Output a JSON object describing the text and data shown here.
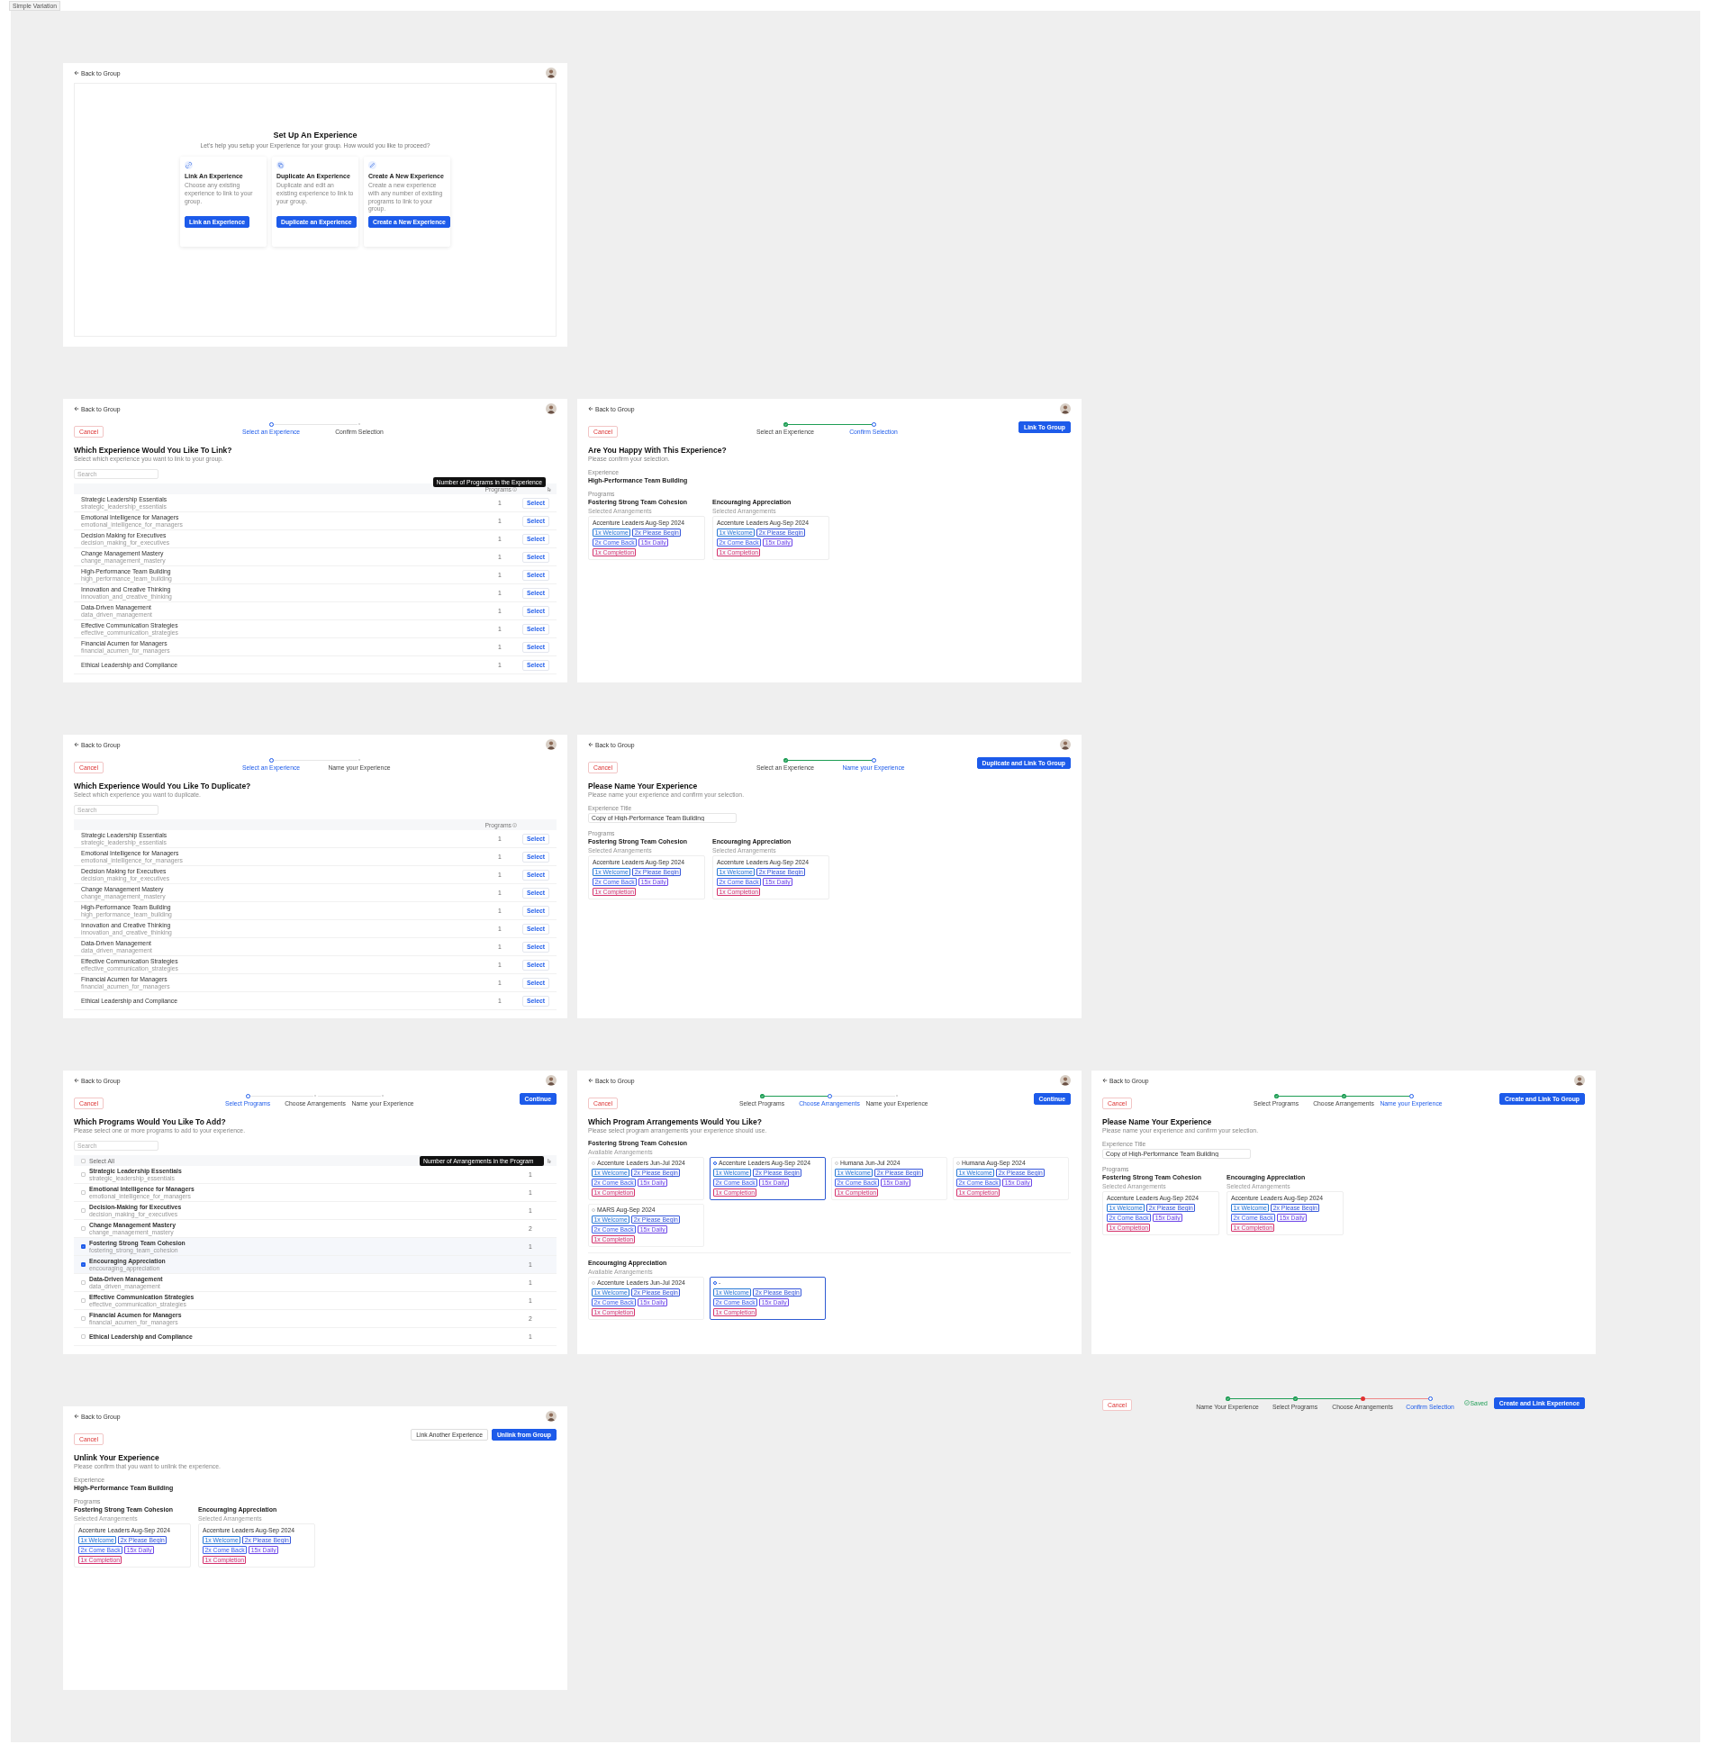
{
  "canvas_label": "Simple Variation",
  "frames": [
    {
      "kind": "setup",
      "back": "Back to Group",
      "title": "Set Up An Experience",
      "subtitle": "Let's help you setup your Experience for your group. How would you like to proceed?",
      "options": [
        {
          "title": "Link An Experience",
          "text": "Choose any existing experience to link to your group.",
          "button": "Link an Experience"
        },
        {
          "title": "Duplicate An Experience",
          "text": "Duplicate and edit an existing experience to link to your group.",
          "button": "Duplicate an Experience"
        },
        {
          "title": "Create A New Experience",
          "text": "Create a new experience with any number of existing programs to link to your group.",
          "button": "Create a New Experience"
        }
      ]
    },
    {
      "kind": "select",
      "back": "Back to Group",
      "cancel": "Cancel",
      "steps": [
        {
          "label": "Select an Experience",
          "done": false,
          "selected": true
        },
        {
          "label": "Confirm Selection",
          "done": false,
          "selected": false
        }
      ],
      "title": "Which Experience Would You Like To Link?",
      "subtitle": "Select which experience you want to link to your group.",
      "search": {
        "placeholder": "Search"
      },
      "count_header": "Programs",
      "tooltip": "Number of Programs in the Experience",
      "rows": [
        {
          "name": "Strategic Leadership Essentials",
          "slug": "strategic_leadership_essentials",
          "count": "1",
          "action": "Select"
        },
        {
          "name": "Emotional Intelligence for Managers",
          "slug": "emotional_intelligence_for_managers",
          "count": "1",
          "action": "Select"
        },
        {
          "name": "Decision Making for Executives",
          "slug": "decision_making_for_executives",
          "count": "1",
          "action": "Select"
        },
        {
          "name": "Change Management Mastery",
          "slug": "change_management_mastery",
          "count": "1",
          "action": "Select"
        },
        {
          "name": "High-Performance Team Building",
          "slug": "high_performance_team_building",
          "count": "1",
          "action": "Select"
        },
        {
          "name": "Innovation and Creative Thinking",
          "slug": "innovation_and_creative_thinking",
          "count": "1",
          "action": "Select"
        },
        {
          "name": "Data-Driven Management",
          "slug": "data_driven_management",
          "count": "1",
          "action": "Select"
        },
        {
          "name": "Effective Communication Strategies",
          "slug": "effective_communication_strategies",
          "count": "1",
          "action": "Select"
        },
        {
          "name": "Financial Acumen for Managers",
          "slug": "financial_acumen_for_managers",
          "count": "1",
          "action": "Select"
        },
        {
          "name": "Ethical Leadership and Compliance",
          "count": "1",
          "action": "Select"
        }
      ]
    },
    {
      "kind": "confirm",
      "back": "Back to Group",
      "cancel": "Cancel",
      "steps": [
        {
          "label": "Select an Experience",
          "done": true,
          "selected": false
        },
        {
          "label": "Confirm Selection",
          "done": false,
          "selected": true
        }
      ],
      "actions": [
        "Link To Group"
      ],
      "title": "Are You Happy With This Experience?",
      "subtitle": "Please confirm your selection.",
      "experience_label": "Experience",
      "experience": "High-Performance Team Building",
      "programs_label": "Programs",
      "programs": [
        {
          "name": "Fostering Strong Team Cohesion",
          "label": "Selected Arrangements",
          "arrangement": {
            "title": "Accenture Leaders Aug-Sep 2024",
            "tags": [
              {
                "label": "1x Welcome",
                "color": "#2b7bd6"
              },
              {
                "label": "2x Please Begin",
                "color": "#3b5bdb"
              },
              {
                "label": "2x Come Back",
                "color": "#4263eb"
              },
              {
                "label": "15x Daily",
                "color": "#7048e8"
              },
              {
                "label": "1x Completion",
                "color": "#d6336c"
              }
            ]
          }
        },
        {
          "name": "Encouraging Appreciation",
          "label": "Selected Arrangements",
          "arrangement": {
            "title": "Accenture Leaders Aug-Sep 2024",
            "tags": [
              {
                "label": "1x Welcome",
                "color": "#2b7bd6"
              },
              {
                "label": "2x Please Begin",
                "color": "#3b5bdb"
              },
              {
                "label": "2x Come Back",
                "color": "#4263eb"
              },
              {
                "label": "15x Daily",
                "color": "#7048e8"
              },
              {
                "label": "1x Completion",
                "color": "#d6336c"
              }
            ]
          }
        }
      ]
    },
    {
      "kind": "select",
      "back": "Back to Group",
      "cancel": "Cancel",
      "steps": [
        {
          "label": "Select an Experience",
          "done": false,
          "selected": true
        },
        {
          "label": "Name your Experience",
          "done": false,
          "selected": false
        }
      ],
      "title": "Which Experience Would You Like To Duplicate?",
      "subtitle": "Select which experience you want to duplicate.",
      "search": {
        "placeholder": "Search"
      },
      "count_header": "Programs",
      "rows": [
        {
          "name": "Strategic Leadership Essentials",
          "slug": "strategic_leadership_essentials",
          "count": "1",
          "action": "Select"
        },
        {
          "name": "Emotional Intelligence for Managers",
          "slug": "emotional_intelligence_for_managers",
          "count": "1",
          "action": "Select"
        },
        {
          "name": "Decision Making for Executives",
          "slug": "decision_making_for_executives",
          "count": "1",
          "action": "Select"
        },
        {
          "name": "Change Management Mastery",
          "slug": "change_management_mastery",
          "count": "1",
          "action": "Select"
        },
        {
          "name": "High-Performance Team Building",
          "slug": "high_performance_team_building",
          "count": "1",
          "action": "Select"
        },
        {
          "name": "Innovation and Creative Thinking",
          "slug": "innovation_and_creative_thinking",
          "count": "1",
          "action": "Select"
        },
        {
          "name": "Data-Driven Management",
          "slug": "data_driven_management",
          "count": "1",
          "action": "Select"
        },
        {
          "name": "Effective Communication Strategies",
          "slug": "effective_communication_strategies",
          "count": "1",
          "action": "Select"
        },
        {
          "name": "Financial Acumen for Managers",
          "slug": "financial_acumen_for_managers",
          "count": "1",
          "action": "Select"
        },
        {
          "name": "Ethical Leadership and Compliance",
          "count": "1",
          "action": "Select"
        }
      ]
    },
    {
      "kind": "name",
      "back": "Back to Group",
      "cancel": "Cancel",
      "steps": [
        {
          "label": "Select an Experience",
          "done": true,
          "selected": false
        },
        {
          "label": "Name your Experience",
          "done": false,
          "selected": true
        }
      ],
      "actions": [
        "Duplicate and Link To Group"
      ],
      "title": "Please Name Your Experience",
      "subtitle": "Please name your experience and confirm your selection.",
      "field": {
        "label": "Experience Title",
        "value": "Copy of High-Performance Team Building"
      },
      "programs_label": "Programs",
      "programs": [
        {
          "name": "Fostering Strong Team Cohesion",
          "label": "Selected Arrangements",
          "arrangement": {
            "title": "Accenture Leaders Aug-Sep 2024",
            "tags": [
              {
                "label": "1x Welcome",
                "color": "#2b7bd6"
              },
              {
                "label": "2x Please Begin",
                "color": "#3b5bdb"
              },
              {
                "label": "2x Come Back",
                "color": "#4263eb"
              },
              {
                "label": "15x Daily",
                "color": "#7048e8"
              },
              {
                "label": "1x Completion",
                "color": "#d6336c"
              }
            ]
          }
        },
        {
          "name": "Encouraging Appreciation",
          "label": "Selected Arrangements",
          "arrangement": {
            "title": "Accenture Leaders Aug-Sep 2024",
            "tags": [
              {
                "label": "1x Welcome",
                "color": "#2b7bd6"
              },
              {
                "label": "2x Please Begin",
                "color": "#3b5bdb"
              },
              {
                "label": "2x Come Back",
                "color": "#4263eb"
              },
              {
                "label": "15x Daily",
                "color": "#7048e8"
              },
              {
                "label": "1x Completion",
                "color": "#d6336c"
              }
            ]
          }
        }
      ]
    },
    {
      "kind": "programs",
      "back": "Back to Group",
      "cancel": "Cancel",
      "steps": [
        {
          "label": "Select Programs",
          "done": false,
          "selected": true
        },
        {
          "label": "Choose Arrangements",
          "done": false,
          "selected": false
        },
        {
          "label": "Name your Experience",
          "done": false,
          "selected": false
        }
      ],
      "actions": [
        "Continue"
      ],
      "title": "Which Programs Would You Like To Add?",
      "subtitle": "Please select one or more programs to add to your experience.",
      "search": {
        "placeholder": "Search"
      },
      "select_all": {
        "label": "Select All",
        "checked": false
      },
      "tooltip": "Number of Arrangements in the Program",
      "rows": [
        {
          "name": "Strategic Leadership Essentials",
          "slug": "strategic_leadership_essentials",
          "count": "1",
          "checked": false
        },
        {
          "name": "Emotional Intelligence for Managers",
          "slug": "emotional_intelligence_for_managers",
          "count": "1",
          "checked": false
        },
        {
          "name": "Decision-Making for Executives",
          "slug": "decision_making_for_executives",
          "count": "1",
          "checked": false
        },
        {
          "name": "Change Management Mastery",
          "slug": "change_management_mastery",
          "count": "2",
          "checked": false
        },
        {
          "name": "Fostering Strong Team Cohesion",
          "slug": "fostering_strong_team_cohesion",
          "count": "1",
          "checked": true
        },
        {
          "name": "Encouraging Appreciation",
          "slug": "encouraging_appreciation",
          "count": "1",
          "checked": true
        },
        {
          "name": "Data-Driven Management",
          "slug": "data_driven_management",
          "count": "1",
          "checked": false
        },
        {
          "name": "Effective Communication Strategies",
          "slug": "effective_communication_strategies",
          "count": "1",
          "checked": false
        },
        {
          "name": "Financial Acumen for Managers",
          "slug": "financial_acumen_for_managers",
          "count": "2",
          "checked": false
        },
        {
          "name": "Ethical Leadership and Compliance",
          "count": "1",
          "checked": false
        }
      ]
    },
    {
      "kind": "arrangements",
      "back": "Back to Group",
      "cancel": "Cancel",
      "steps": [
        {
          "label": "Select Programs",
          "done": true,
          "selected": false
        },
        {
          "label": "Choose Arrangements",
          "done": false,
          "selected": true
        },
        {
          "label": "Name your Experience",
          "done": false,
          "selected": false
        }
      ],
      "actions": [
        "Continue"
      ],
      "title": "Which Program Arrangements Would You Like?",
      "subtitle": "Please select program arrangements your experience should use.",
      "sections": [
        {
          "name": "Fostering Strong Team Cohesion",
          "label": "Available Arrangements",
          "arrangements": [
            {
              "title": "Accenture Leaders Jun-Jul 2024",
              "selected": false,
              "tags": [
                {
                  "label": "1x Welcome",
                  "color": "#2b7bd6"
                },
                {
                  "label": "2x Please Begin",
                  "color": "#3b5bdb"
                },
                {
                  "label": "2x Come Back",
                  "color": "#4263eb"
                },
                {
                  "label": "15x Daily",
                  "color": "#7048e8"
                },
                {
                  "label": "1x Completion",
                  "color": "#d6336c"
                }
              ]
            },
            {
              "title": "Accenture Leaders Aug-Sep 2024",
              "selected": true,
              "tags": [
                {
                  "label": "1x Welcome",
                  "color": "#2b7bd6"
                },
                {
                  "label": "2x Please Begin",
                  "color": "#3b5bdb"
                },
                {
                  "label": "2x Come Back",
                  "color": "#4263eb"
                },
                {
                  "label": "15x Daily",
                  "color": "#7048e8"
                },
                {
                  "label": "1x Completion",
                  "color": "#d6336c"
                }
              ]
            },
            {
              "title": "Humana Jun-Jul 2024",
              "selected": false,
              "tags": [
                {
                  "label": "1x Welcome",
                  "color": "#2b7bd6"
                },
                {
                  "label": "2x Please Begin",
                  "color": "#3b5bdb"
                },
                {
                  "label": "2x Come Back",
                  "color": "#4263eb"
                },
                {
                  "label": "15x Daily",
                  "color": "#7048e8"
                },
                {
                  "label": "1x Completion",
                  "color": "#d6336c"
                }
              ]
            },
            {
              "title": "Humana Aug-Sep 2024",
              "selected": false,
              "tags": [
                {
                  "label": "1x Welcome",
                  "color": "#2b7bd6"
                },
                {
                  "label": "2x Please Begin",
                  "color": "#3b5bdb"
                },
                {
                  "label": "2x Come Back",
                  "color": "#4263eb"
                },
                {
                  "label": "15x Daily",
                  "color": "#7048e8"
                },
                {
                  "label": "1x Completion",
                  "color": "#d6336c"
                }
              ]
            },
            {
              "title": "MARS Aug-Sep 2024",
              "selected": false,
              "tags": [
                {
                  "label": "1x Welcome",
                  "color": "#2b7bd6"
                },
                {
                  "label": "2x Please Begin",
                  "color": "#3b5bdb"
                },
                {
                  "label": "2x Come Back",
                  "color": "#4263eb"
                },
                {
                  "label": "15x Daily",
                  "color": "#7048e8"
                },
                {
                  "label": "1x Completion",
                  "color": "#d6336c"
                }
              ]
            }
          ]
        },
        {
          "name": "Encouraging Appreciation",
          "label": "Available Arrangements",
          "arrangements": [
            {
              "title": "Accenture Leaders Jun-Jul 2024",
              "selected": false,
              "tags": [
                {
                  "label": "1x Welcome",
                  "color": "#2b7bd6"
                },
                {
                  "label": "2x Please Begin",
                  "color": "#3b5bdb"
                },
                {
                  "label": "2x Come Back",
                  "color": "#4263eb"
                },
                {
                  "label": "15x Daily",
                  "color": "#7048e8"
                },
                {
                  "label": "1x Completion",
                  "color": "#d6336c"
                }
              ]
            },
            {
              "title": "-",
              "selected": true,
              "tags": [
                {
                  "label": "1x Welcome",
                  "color": "#2b7bd6"
                },
                {
                  "label": "2x Please Begin",
                  "color": "#3b5bdb"
                },
                {
                  "label": "2x Come Back",
                  "color": "#4263eb"
                },
                {
                  "label": "15x Daily",
                  "color": "#7048e8"
                },
                {
                  "label": "1x Completion",
                  "color": "#d6336c"
                }
              ]
            }
          ]
        }
      ]
    },
    {
      "kind": "name",
      "back": "Back to Group",
      "cancel": "Cancel",
      "steps": [
        {
          "label": "Select Programs",
          "done": true,
          "selected": false
        },
        {
          "label": "Choose Arrangements",
          "done": true,
          "selected": false
        },
        {
          "label": "Name your Experience",
          "done": false,
          "selected": true
        }
      ],
      "actions": [
        "Create and Link To Group"
      ],
      "title": "Please Name Your Experience",
      "subtitle": "Please name your experience and confirm your selection.",
      "field": {
        "label": "Experience Title",
        "value": "Copy of High-Performance Team Building"
      },
      "programs_label": "Programs",
      "programs": [
        {
          "name": "Fostering Strong Team Cohesion",
          "label": "Selected Arrangements",
          "arrangement": {
            "title": "Accenture Leaders Aug-Sep 2024",
            "tags": [
              {
                "label": "1x Welcome",
                "color": "#2b7bd6"
              },
              {
                "label": "2x Please Begin",
                "color": "#3b5bdb"
              },
              {
                "label": "2x Come Back",
                "color": "#4263eb"
              },
              {
                "label": "15x Daily",
                "color": "#7048e8"
              },
              {
                "label": "1x Completion",
                "color": "#d6336c"
              }
            ]
          }
        },
        {
          "name": "Encouraging Appreciation",
          "label": "Selected Arrangements",
          "arrangement": {
            "title": "Accenture Leaders Aug-Sep 2024",
            "tags": [
              {
                "label": "1x Welcome",
                "color": "#2b7bd6"
              },
              {
                "label": "2x Please Begin",
                "color": "#3b5bdb"
              },
              {
                "label": "2x Come Back",
                "color": "#4263eb"
              },
              {
                "label": "15x Daily",
                "color": "#7048e8"
              },
              {
                "label": "1x Completion",
                "color": "#d6336c"
              }
            ]
          }
        }
      ]
    },
    {
      "kind": "confirm",
      "back": "Back to Group",
      "cancel": "Cancel",
      "actions": [
        "Link Another Experience",
        "Unlink from Group"
      ],
      "title": "Unlink Your Experience",
      "subtitle": "Please confirm that you want to unlink the experience.",
      "experience_label": "Experience",
      "experience": "High-Performance Team Building",
      "programs_label": "Programs",
      "programs": [
        {
          "name": "Fostering Strong Team Cohesion",
          "label": "Selected Arrangements",
          "arrangement": {
            "title": "Accenture Leaders Aug-Sep 2024",
            "tags": [
              {
                "label": "1x Welcome",
                "color": "#2b7bd6"
              },
              {
                "label": "2x Please Begin",
                "color": "#3b5bdb"
              },
              {
                "label": "2x Come Back",
                "color": "#4263eb"
              },
              {
                "label": "15x Daily",
                "color": "#7048e8"
              },
              {
                "label": "1x Completion",
                "color": "#d6336c"
              }
            ]
          }
        },
        {
          "name": "Encouraging Appreciation",
          "label": "Selected Arrangements",
          "arrangement": {
            "title": "Accenture Leaders Aug-Sep 2024",
            "tags": [
              {
                "label": "1x Welcome",
                "color": "#2b7bd6"
              },
              {
                "label": "2x Please Begin",
                "color": "#3b5bdb"
              },
              {
                "label": "2x Come Back",
                "color": "#4263eb"
              },
              {
                "label": "15x Daily",
                "color": "#7048e8"
              },
              {
                "label": "1x Completion",
                "color": "#d6336c"
              }
            ]
          }
        }
      ]
    },
    {
      "kind": "stepbar",
      "cancel": "Cancel",
      "steps": [
        {
          "label": "Name Your Experience",
          "done": true,
          "selected": false,
          "error": false
        },
        {
          "label": "Select Programs",
          "done": true,
          "selected": false,
          "error": false
        },
        {
          "label": "Choose Arrangements",
          "done": false,
          "selected": false,
          "error": true
        },
        {
          "label": "Confirm Selection",
          "done": false,
          "selected": true,
          "error": false
        }
      ],
      "saved": "Saved",
      "actions": [
        "Create and Link Experience"
      ]
    }
  ]
}
